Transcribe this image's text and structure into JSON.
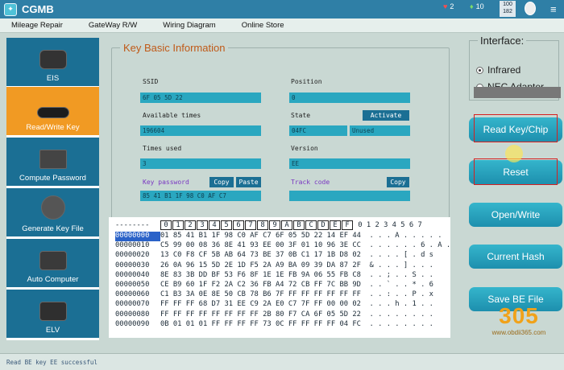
{
  "app": {
    "title": "CGMB"
  },
  "titlebar": {
    "hearts": "2",
    "leaf": "10",
    "counter_top": "100",
    "counter_bottom": "182"
  },
  "menu": [
    "Mileage Repair",
    "GateWay R/W",
    "Wiring Diagram",
    "Online Store"
  ],
  "sidebar": {
    "items": [
      {
        "label": "EIS",
        "active": false
      },
      {
        "label": "Read/Write Key",
        "active": true
      },
      {
        "label": "Compute Password",
        "active": false
      },
      {
        "label": "Generate Key File",
        "active": false
      },
      {
        "label": "Auto Computer",
        "active": false
      },
      {
        "label": "ELV",
        "active": false
      }
    ]
  },
  "key_info": {
    "title": "Key Basic Information",
    "ssid_label": "SSID",
    "ssid": "6F 05 5D 22",
    "position_label": "Position",
    "position": "0",
    "available_label": "Available times",
    "available": "196604",
    "state_label": "State",
    "activate_btn": "Activate",
    "state": "04FC",
    "state2": "Unused",
    "times_used_label": "Times used",
    "times_used": "3",
    "version_label": "Version",
    "version": "EE",
    "key_password_label": "Key password",
    "copy1": "Copy",
    "paste": "Paste",
    "key_password": "85 41 B1 1F 98 C0 AF C7",
    "track_label": "Track code",
    "copy2": "Copy",
    "track": ""
  },
  "hex": {
    "header_prefix": "--------",
    "columns": [
      "0",
      "1",
      "2",
      "3",
      "4",
      "5",
      "6",
      "7",
      "8",
      "9",
      "A",
      "B",
      "C",
      "D",
      "E",
      "F"
    ],
    "ascii_header": "0 1 2 3 4 5 6 7",
    "rows": [
      {
        "addr": "00000000",
        "bytes": "01 85 41 B1 1F 98 C0 AF C7 6F 05 5D 22 14 EF 44",
        "ascii": ". . . A . . . . ."
      },
      {
        "addr": "00000010",
        "bytes": "C5 99 00 08 36 8E 41 93 EE 00 3F 01 10 96 3E CC",
        "ascii": ". . . . . . 6 . A ."
      },
      {
        "addr": "00000020",
        "bytes": "13 C0 F8 CF 5B AB 64 73 BE 37 0B C1 17 1B D8 02",
        "ascii": ". . . . [ . d s"
      },
      {
        "addr": "00000030",
        "bytes": "26 0A 96 15 5D 2E 1D F5 2A A9 BA 09 39 DA 87 2F",
        "ascii": "& . . . ] . . ."
      },
      {
        "addr": "00000040",
        "bytes": "8E 83 3B DD BF 53 F6 8F 1E 1E FB 9A 06 55 FB C8",
        "ascii": ". . ; . . S . ."
      },
      {
        "addr": "00000050",
        "bytes": "CE B9 60 1F F2 2A C2 36 FB A4 72 CB FF 7C BB 9D",
        "ascii": ". . ` . . * . 6"
      },
      {
        "addr": "00000060",
        "bytes": "C1 B3 3A 0E 8E 50 CB 78 B6 7F FF FF FF FF FF FF",
        "ascii": ". . : . . P . x"
      },
      {
        "addr": "00000070",
        "bytes": "FF FF FF 68 D7 31 EE C9 2A E0 C7 7F FF 00 00 02",
        "ascii": ". . . h . 1 . ."
      },
      {
        "addr": "00000080",
        "bytes": "FF FF FF FF FF FF FF FF 2B 80 F7 CA 6F 05 5D 22",
        "ascii": ". . . . . . . ."
      },
      {
        "addr": "00000090",
        "bytes": "0B 01 01 01 FF FF FF FF 73 0C FF FF FF FF 04 FC",
        "ascii": ". . . . . . . ."
      }
    ]
  },
  "interface": {
    "title": "Interface:",
    "options": [
      "Infrared",
      "NEC Adapter"
    ],
    "selected": "Infrared"
  },
  "buttons": [
    "Read Key/Chip",
    "Reset",
    "Open/Write",
    "Current Hash",
    "Save BE File"
  ],
  "status": "Read BE key EE successful",
  "watermark": {
    "brand": "305",
    "url": "www.obdii365.com"
  },
  "colors": {
    "accent": "#1b6f94",
    "active": "#f19a23",
    "highlight": "#d62020"
  }
}
